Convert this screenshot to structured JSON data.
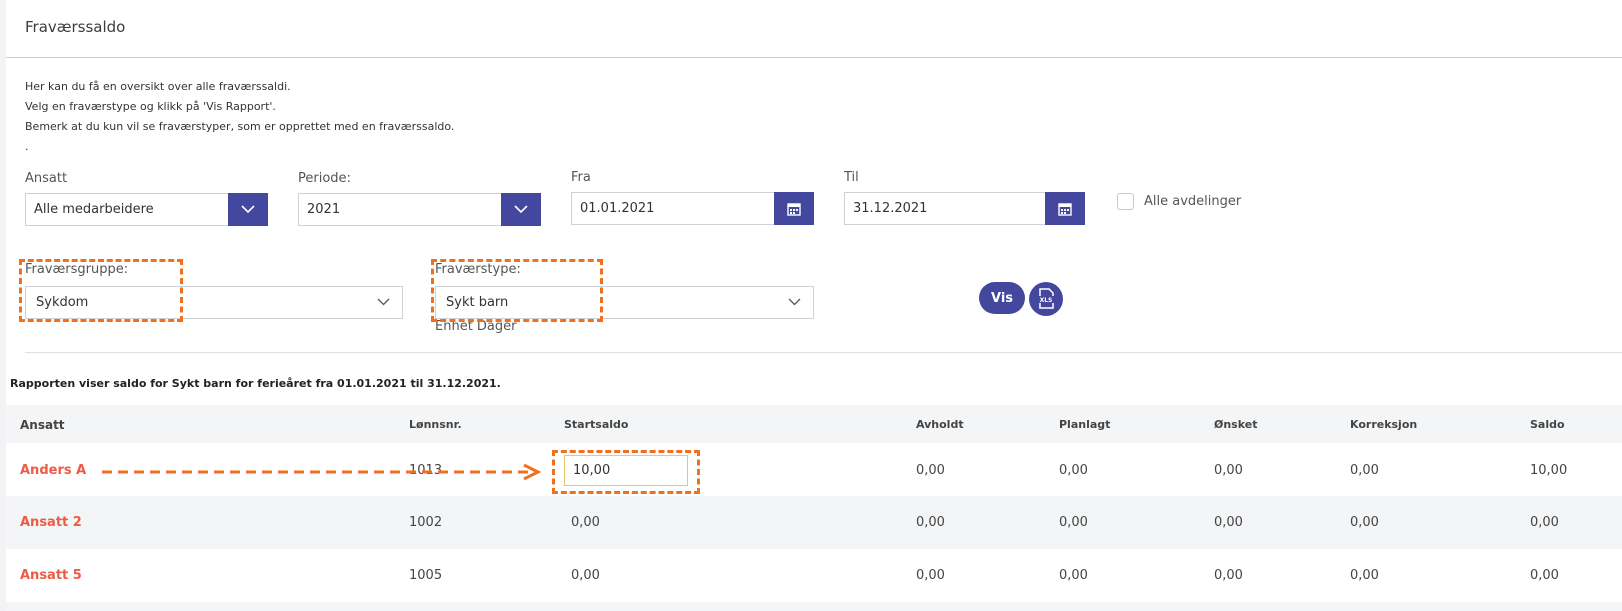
{
  "page": {
    "title": "Fraværssaldo",
    "intro": [
      "Her kan du få en oversikt over alle fraværssaldi.",
      "Velg en fraværstype og klikk på 'Vis Rapport'.",
      "Bemerk at du kun vil se fraværstyper, som er opprettet med en fraværssaldo.",
      "."
    ]
  },
  "filters": {
    "ansatt": {
      "label": "Ansatt",
      "value": "Alle medarbeidere"
    },
    "periode": {
      "label": "Periode:",
      "value": "2021"
    },
    "fra": {
      "label": "Fra",
      "value": "01.01.2021"
    },
    "til": {
      "label": "Til",
      "value": "31.12.2021"
    },
    "alle_avdelinger": {
      "label": "Alle avdelinger",
      "checked": false
    },
    "fravaersgruppe": {
      "label": "Fraværsgruppe:",
      "value": "Sykdom"
    },
    "fravaerstype": {
      "label": "Fraværstype:",
      "value": "Sykt barn",
      "unit": "Enhet Dager"
    },
    "vis_label": "Vis",
    "xls_label": "XLS"
  },
  "report": {
    "summary": "Rapporten viser saldo for Sykt barn for ferieåret fra 01.01.2021 til 31.12.2021.",
    "columns": [
      "Ansatt",
      "Lønnsnr.",
      "Startsaldo",
      "Avholdt",
      "Planlagt",
      "Ønsket",
      "Korreksjon",
      "Saldo"
    ],
    "rows": [
      {
        "ansatt": "Anders A",
        "lonnsnr": "1013",
        "startsaldo": "10,00",
        "avholdt": "0,00",
        "planlagt": "0,00",
        "onsket": "0,00",
        "korreksjon": "0,00",
        "saldo": "10,00"
      },
      {
        "ansatt": "Ansatt 2",
        "lonnsnr": "1002",
        "startsaldo": "0,00",
        "avholdt": "0,00",
        "planlagt": "0,00",
        "onsket": "0,00",
        "korreksjon": "0,00",
        "saldo": "0,00"
      },
      {
        "ansatt": "Ansatt 5",
        "lonnsnr": "1005",
        "startsaldo": "0,00",
        "avholdt": "0,00",
        "planlagt": "0,00",
        "onsket": "0,00",
        "korreksjon": "0,00",
        "saldo": "0,00"
      }
    ]
  },
  "colors": {
    "accent": "#43489e",
    "employee_link": "#ef5a45",
    "annotation": "#f07020",
    "title_rule": "#e8cf8a"
  },
  "icons": [
    "chevron-down-icon",
    "calendar-icon",
    "xls-file-icon",
    "arrow-right-icon"
  ]
}
